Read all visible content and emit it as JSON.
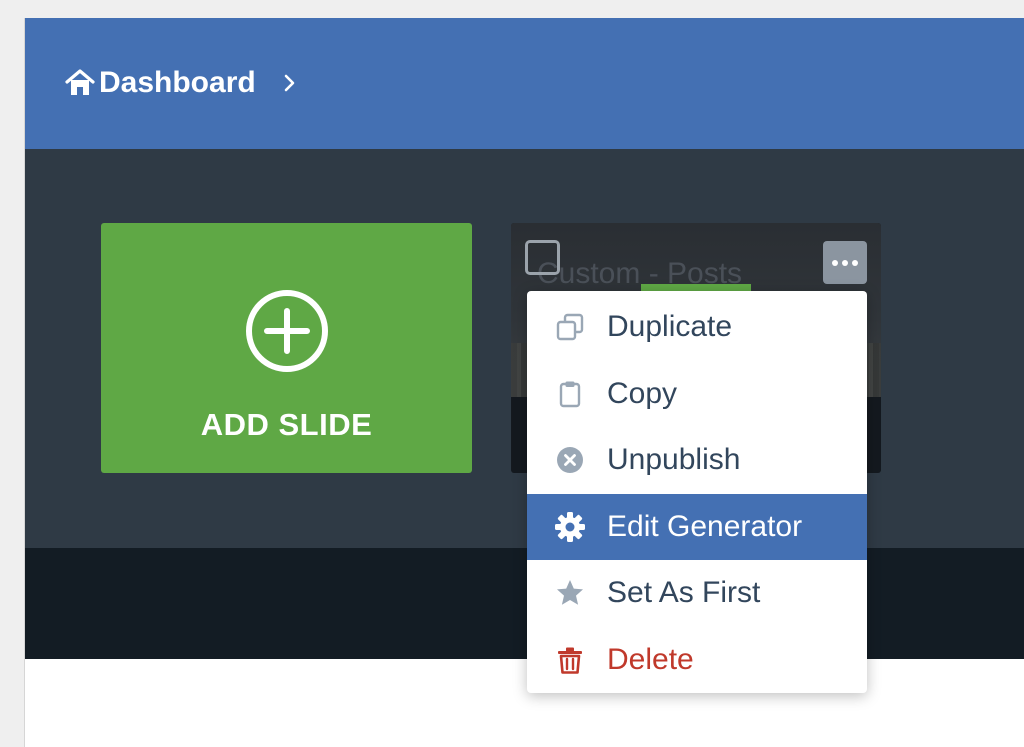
{
  "breadcrumb": {
    "label": "Dashboard",
    "icon": "home-icon",
    "separator_icon": "chevron-right-icon"
  },
  "add_slide": {
    "label": "ADD SLIDE",
    "icon": "plus-circle-icon"
  },
  "slide": {
    "title": "Custom - Posts"
  },
  "context_menu": {
    "items": [
      {
        "label": "Duplicate",
        "icon": "duplicate-icon"
      },
      {
        "label": "Copy",
        "icon": "clipboard-icon"
      },
      {
        "label": "Unpublish",
        "icon": "unpublish-icon"
      },
      {
        "label": "Edit Generator",
        "icon": "gear-icon",
        "state": "highlighted"
      },
      {
        "label": "Set As First",
        "icon": "star-icon"
      },
      {
        "label": "Delete",
        "icon": "trash-icon",
        "state": "danger"
      }
    ]
  },
  "colors": {
    "header": "#4470b3",
    "accent_green": "#5fa845",
    "menu_highlight": "#4470b3",
    "danger": "#c0392b"
  }
}
